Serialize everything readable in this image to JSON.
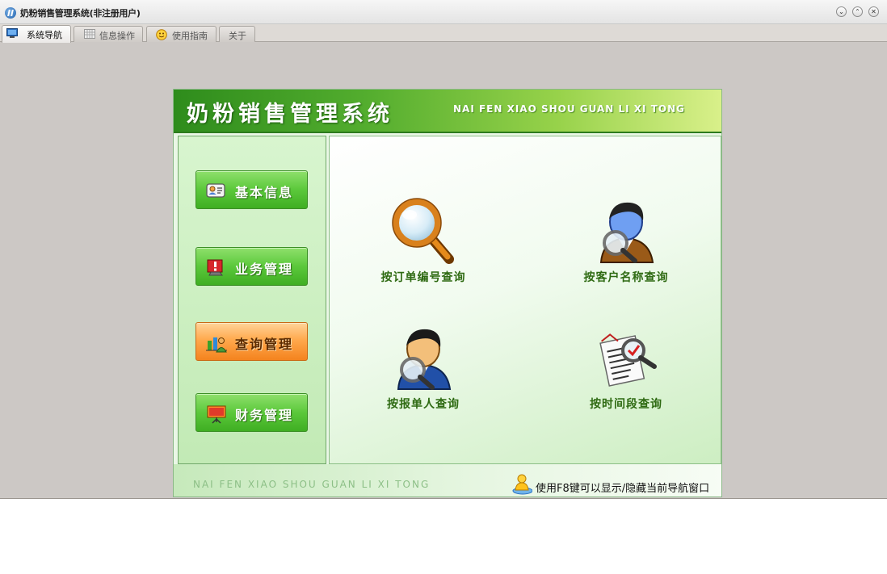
{
  "window": {
    "title": "奶粉销售管理系统(非注册用户)",
    "controls": {
      "minimize": "⌄",
      "maximize": "⌃",
      "close": "✕"
    }
  },
  "tabs": [
    {
      "label": "系统导航",
      "icon": "monitor-icon",
      "active": true
    },
    {
      "label": "信息操作",
      "icon": "grid-icon",
      "active": false
    },
    {
      "label": "使用指南",
      "icon": "smiley-icon",
      "active": false
    },
    {
      "label": "关于",
      "icon": "",
      "active": false
    }
  ],
  "banner": {
    "title": "奶粉销售管理系统",
    "subtitle": "NAI FEN XIAO SHOU GUAN LI XI TONG"
  },
  "sidebar": {
    "items": [
      {
        "label": "基本信息",
        "icon": "id-card-icon",
        "active": false
      },
      {
        "label": "业务管理",
        "icon": "alert-monitor-icon",
        "active": false
      },
      {
        "label": "查询管理",
        "icon": "chart-person-icon",
        "active": true
      },
      {
        "label": "财务管理",
        "icon": "presentation-board-icon",
        "active": false
      }
    ]
  },
  "queries": [
    {
      "label": "按订单编号查询",
      "icon": "magnifier-icon"
    },
    {
      "label": "按客户名称查询",
      "icon": "user-search-icon"
    },
    {
      "label": "按报单人查询",
      "icon": "user-search-icon"
    },
    {
      "label": "按时间段查询",
      "icon": "document-search-icon"
    }
  ],
  "footer": {
    "brand": "NAI FEN XIAO SHOU GUAN LI XI TONG",
    "tip": "使用F8键可以显示/隐藏当前导航窗口",
    "tip_icon": "user-tip-icon"
  },
  "colors": {
    "window_bg": "#ccc8c5",
    "banner_green": "#2e8c1c",
    "nav_green": "#5bc83b",
    "nav_active_orange": "#f4831e",
    "query_label_green": "#2e6a12"
  }
}
